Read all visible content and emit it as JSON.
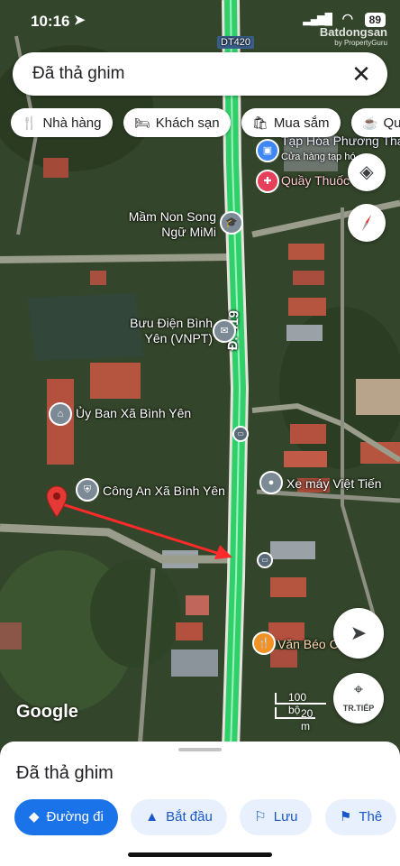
{
  "status_bar": {
    "time": "10:16",
    "battery": "89"
  },
  "watermark": {
    "brand": "Batdongsan",
    "sub": "by PropertyGuru"
  },
  "search": {
    "query": "Đã thả ghim"
  },
  "chips": [
    {
      "label": "Nhà hàng",
      "icon": "fork-knife-icon"
    },
    {
      "label": "Khách sạn",
      "icon": "bed-icon"
    },
    {
      "label": "Mua sắm",
      "icon": "shopping-bag-icon"
    },
    {
      "label": "Quán",
      "icon": "cup-icon"
    }
  ],
  "map_labels": {
    "road_dt420": "DT420",
    "road_d419": "Đ. 419",
    "shop_1": "Tạp Hóa Phương Tha",
    "shop_1_sub": "Cửa hàng tạp hó",
    "pharmacy": "Quầy Thuốc",
    "kindergarten": "Mầm Non Song Ngữ MiMi",
    "post_office": "Bưu Điện Bình Yên (VNPT)",
    "commune_office": "Ủy Ban Xã Bình Yên",
    "police": "Công An Xã Bình Yên",
    "motorbike": "Xe máy Việt Tiến",
    "restaurant": "Văn Béo C"
  },
  "map_attribution": "Google",
  "scale": {
    "imperial": "100 bộ",
    "metric": "20 m"
  },
  "buttons": {
    "transit": "TR.TIẾP"
  },
  "sheet": {
    "title": "Đã thả ghim",
    "actions": [
      {
        "label": "Đường đi",
        "icon": "directions-icon",
        "primary": true
      },
      {
        "label": "Bắt đầu",
        "icon": "navigation-arrow-icon",
        "primary": false
      },
      {
        "label": "Lưu",
        "icon": "bookmark-icon",
        "primary": false
      },
      {
        "label": "Thê",
        "icon": "flag-icon",
        "primary": false
      }
    ]
  },
  "colors": {
    "main_road": "#2fd06a",
    "pin": "#e53935",
    "arrow": "#ff2a2a",
    "primary": "#1a73e8"
  }
}
